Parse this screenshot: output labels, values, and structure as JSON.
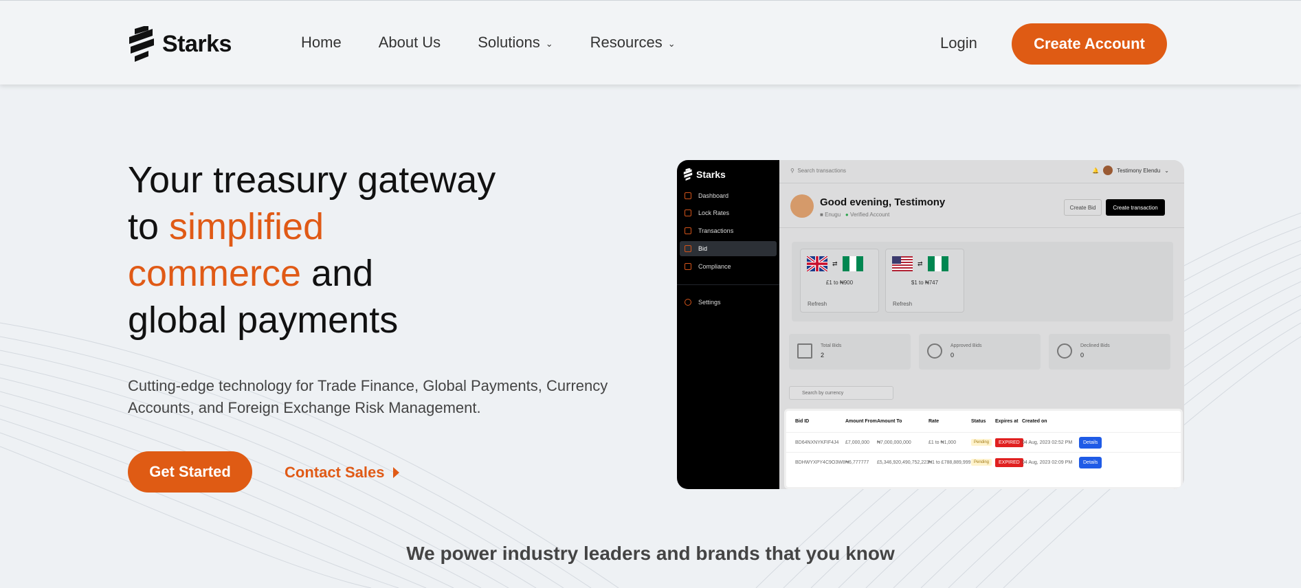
{
  "nav": {
    "logo_text": "Starks",
    "links": [
      "Home",
      "About Us",
      "Solutions",
      "Resources"
    ],
    "login_label": "Login",
    "cta_label": "Create Account"
  },
  "hero": {
    "title_l1": "Your treasury gateway",
    "title_l2a": "to ",
    "title_l2b": "simplified",
    "title_l3a": "commerce",
    "title_l3b": " and",
    "title_l4": "global payments",
    "subtitle": "Cutting-edge technology for Trade Finance, Global Payments, Currency Accounts, and Foreign Exchange Risk Management.",
    "primary_cta": "Get Started",
    "secondary_cta": "Contact Sales"
  },
  "tagline": "We power industry leaders and brands that you know",
  "colors": {
    "accent": "#df5b14",
    "background": "#eef1f4"
  },
  "mockup": {
    "logo_text": "Starks",
    "sidebar_items": [
      "Dashboard",
      "Lock Rates",
      "Transactions",
      "Bid",
      "Compliance"
    ],
    "settings_label": "Settings",
    "active_item": "Bid",
    "search_placeholder": "Search transactions",
    "user_name": "Testimony Elendu",
    "greeting": "Good evening, Testimony",
    "location": "Enugu",
    "verified": "Verified Account",
    "btn_create_bid": "Create Bid",
    "btn_create_tx": "Create transaction",
    "rates": [
      {
        "label": "£1 to ₦900",
        "refresh": "Refresh"
      },
      {
        "label": "$1 to ₦747",
        "refresh": "Refresh"
      }
    ],
    "stats": [
      {
        "label": "Total Bids",
        "value": "2"
      },
      {
        "label": "Approved Bids",
        "value": "0"
      },
      {
        "label": "Declined Bids",
        "value": "0"
      }
    ],
    "currency_search": "Search by currency",
    "table": {
      "headers": [
        "Bid ID",
        "Amount From",
        "Amount To",
        "Rate",
        "Status",
        "Expires at",
        "Created on"
      ],
      "rows": [
        {
          "id": "BD64NXNYKFIF4J4",
          "from": "£7,000,000",
          "to": "₦7,000,000,000",
          "rate": "£1 to ₦1,000",
          "status": "Pending",
          "expires": "EXPIRED",
          "created": "04 Aug, 2023 02:52 PM",
          "action": "Details"
        },
        {
          "id": "BDHWYXPY4C9O3W8",
          "from": "₦6,777777",
          "to": "£5,346,920,490,752,223",
          "rate": "₦1 to £788,889,999",
          "status": "Pending",
          "expires": "EXPIRED",
          "created": "04 Aug, 2023 02:09 PM",
          "action": "Details"
        }
      ]
    }
  }
}
